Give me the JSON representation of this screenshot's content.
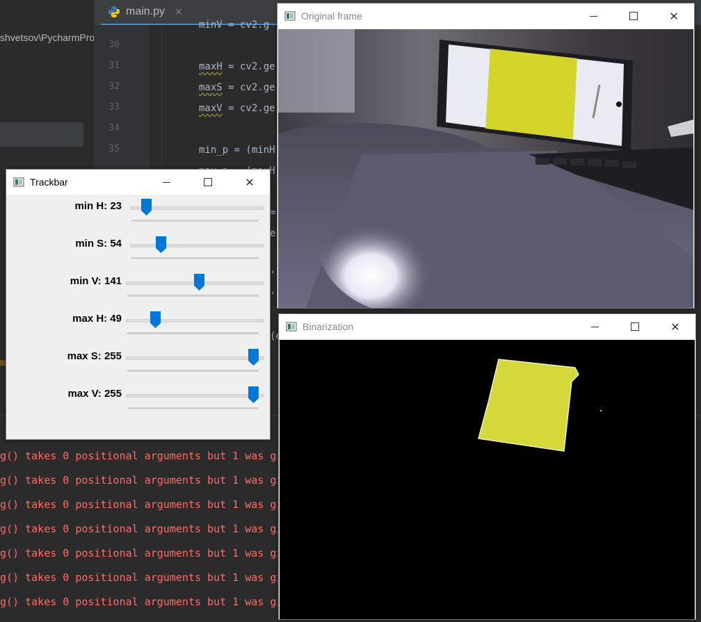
{
  "ide": {
    "path_fragment": "shvetsov\\PycharmPro",
    "tab_name": "main.py",
    "tab_close": "×",
    "line_numbers": [
      "30",
      "31",
      "32",
      "33",
      "34",
      "35"
    ],
    "code_lines": {
      "l29": "minV = cv2.g",
      "l31_var": "maxH",
      "l31_rest": " = cv2.ge",
      "l32_var": "maxS",
      "l32_rest": " = cv2.ge",
      "l33_var": "maxV",
      "l33_rest": " = cv2.ge",
      "l35": "min_p = (minH",
      "l36": "max_p = (maxH",
      "l38": "=",
      "l39": "e",
      "l40": "'(",
      "l41": "'(",
      "l42": "(e"
    },
    "console_error": "g() takes 0 positional arguments but 1 was gi",
    "console_repeat": 7
  },
  "trackbar_window": {
    "title": "Trackbar",
    "sliders": [
      {
        "label": "min H: 23",
        "value": 23,
        "max": 255
      },
      {
        "label": "min S: 54",
        "value": 54,
        "max": 255
      },
      {
        "label": "min V: 141",
        "value": 141,
        "max": 255
      },
      {
        "label": "max H: 49",
        "value": 49,
        "max": 255
      },
      {
        "label": "max S: 255",
        "value": 255,
        "max": 255
      },
      {
        "label": "max V: 255",
        "value": 255,
        "max": 255
      }
    ]
  },
  "original_window": {
    "title": "Original frame"
  },
  "binarization_window": {
    "title": "Binarization"
  },
  "colors": {
    "accent": "#0078d7",
    "yellow": "#d9de2e",
    "error": "#ff6b68"
  }
}
